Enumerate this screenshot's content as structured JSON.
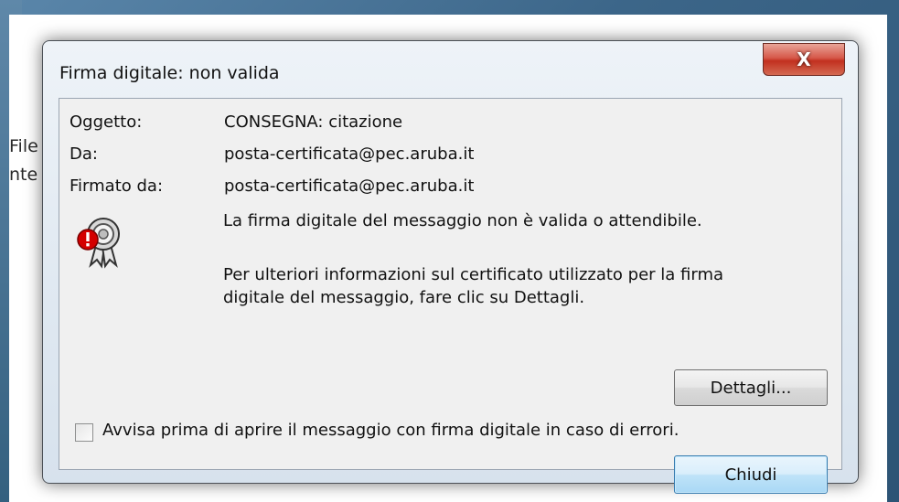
{
  "background": {
    "fragments": [
      "File",
      "nte"
    ]
  },
  "dialog": {
    "title": "Firma digitale: non valida",
    "close_glyph": "X",
    "fields": [
      {
        "label": "Oggetto:",
        "value": "CONSEGNA: citazione"
      },
      {
        "label": "Da:",
        "value": "posta-certificata@pec.aruba.it"
      },
      {
        "label": "Firmato da:",
        "value": "posta-certificata@pec.aruba.it"
      }
    ],
    "icon": "certificate-warning-icon",
    "message_main": "La firma digitale del messaggio non è valida o attendibile.",
    "message_info_line1": "Per ulteriori informazioni sul certificato utilizzato per la firma",
    "message_info_line2": "digitale del messaggio, fare clic su Dettagli.",
    "details_button": "Dettagli...",
    "checkbox_label": "Avvisa prima di aprire il messaggio con firma digitale in caso di errori.",
    "checkbox_checked": false,
    "close_button": "Chiudi"
  },
  "colors": {
    "accent": "#3c7fb1",
    "close_red": "#c2301f",
    "warning_red": "#d40000"
  }
}
